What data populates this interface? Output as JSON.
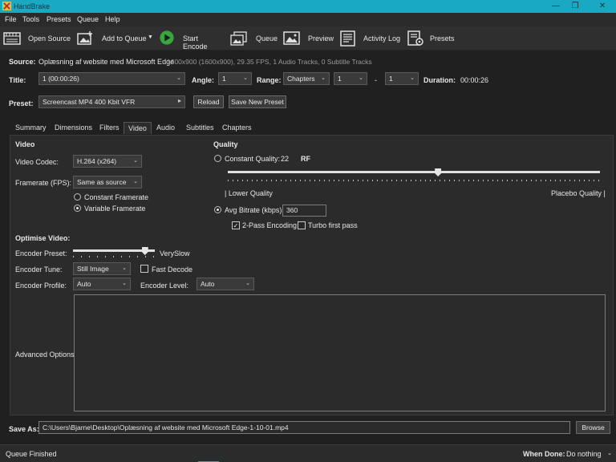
{
  "window": {
    "title": "HandBrake",
    "minimize": "—",
    "maximize": "❐",
    "close": "✕"
  },
  "menu": [
    "File",
    "Tools",
    "Presets",
    "Queue",
    "Help"
  ],
  "toolbar": {
    "open_source": "Open Source",
    "add_to_queue": "Add to Queue",
    "start_encode": "Start Encode",
    "queue": "Queue",
    "preview": "Preview",
    "activity_log": "Activity Log",
    "presets": "Presets"
  },
  "source": {
    "label": "Source:",
    "name": "Oplæsning af website med Microsoft Edge",
    "info": "1600x900 (1600x900), 29.35 FPS, 1 Audio Tracks, 0 Subtitle Tracks"
  },
  "title_row": {
    "title_label": "Title:",
    "title_value": "1  (00:00:26)",
    "angle_label": "Angle:",
    "angle_value": "1",
    "range_label": "Range:",
    "range_value": "Chapters",
    "range_start": "1",
    "range_sep": "-",
    "range_end": "1",
    "duration_label": "Duration:",
    "duration_value": "00:00:26"
  },
  "preset_row": {
    "label": "Preset:",
    "value": "Screencast MP4 400 Kbit VFR",
    "reload": "Reload",
    "save_new": "Save New Preset"
  },
  "tabs": [
    "Summary",
    "Dimensions",
    "Filters",
    "Video",
    "Audio",
    "Subtitles",
    "Chapters"
  ],
  "active_tab": "Video",
  "video": {
    "heading": "Video",
    "codec_label": "Video Codec:",
    "codec_value": "H.264 (x264)",
    "framerate_label": "Framerate (FPS):",
    "framerate_value": "Same as source",
    "constant_framerate": "Constant Framerate",
    "variable_framerate": "Variable Framerate",
    "framerate_mode": "variable"
  },
  "quality": {
    "heading": "Quality",
    "constant_quality_label": "Constant Quality:",
    "rf_value": "22",
    "rf_label": "RF",
    "slider_fraction": 0.565,
    "lower_label": "| Lower Quality",
    "upper_label": "Placebo Quality |",
    "avg_bitrate_label": "Avg Bitrate (kbps):",
    "avg_bitrate_value": "360",
    "mode": "avg_bitrate",
    "two_pass_label": "2-Pass Encoding",
    "two_pass_checked": true,
    "turbo_label": "Turbo first pass",
    "turbo_checked": false
  },
  "optimise": {
    "heading": "Optimise Video:",
    "preset_label": "Encoder Preset:",
    "preset_slider_fraction": 0.88,
    "preset_value": "VerySlow",
    "tune_label": "Encoder Tune:",
    "tune_value": "Still Image",
    "fast_decode_label": "Fast Decode",
    "fast_decode_checked": false,
    "profile_label": "Encoder Profile:",
    "profile_value": "Auto",
    "level_label": "Encoder Level:",
    "level_value": "Auto",
    "advanced_label": "Advanced Options:",
    "advanced_value": ""
  },
  "save_as": {
    "label": "Save As:",
    "path": "C:\\Users\\Bjarne\\Desktop\\Oplæsning af website med Microsoft Edge-1-10-01.mp4",
    "browse": "Browse"
  },
  "status": {
    "text": "Queue Finished",
    "when_done_label": "When Done:",
    "when_done_value": "Do nothing"
  },
  "colors": {
    "titlebar": "#1aa9c2",
    "play_green": "#3aa641",
    "accent_bar": "#1aa9c2"
  }
}
